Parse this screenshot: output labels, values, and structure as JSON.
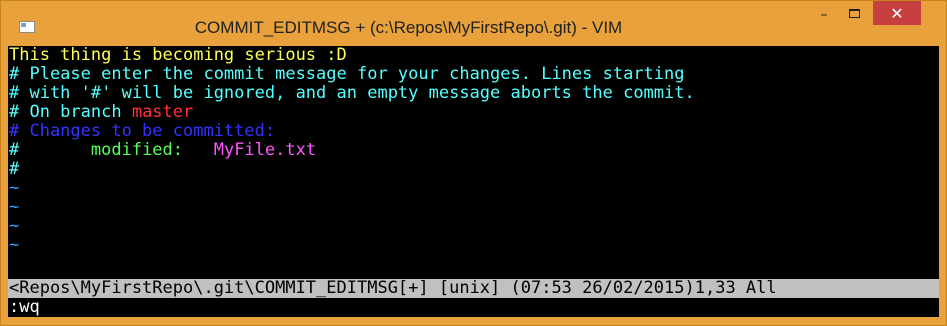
{
  "window": {
    "title": "COMMIT_EDITMSG + (c:\\Repos\\MyFirstRepo\\.git) - VIM",
    "minimize_glyph": "–",
    "close_glyph": "✕",
    "app_icon": "vim-app-icon"
  },
  "editor": {
    "line1": "This thing is becoming serious :D",
    "line2": "# Please enter the commit message for your changes. Lines starting",
    "line3": "# with '#' will be ignored, and an empty message aborts the commit.",
    "line4_prefix": "# On branch ",
    "line4_branch": "master",
    "line5": "# Changes to be committed:",
    "line6_hash": "#",
    "line6_status": "       modified:   ",
    "line6_file": "MyFile.txt",
    "line7": "#",
    "tilde": "~"
  },
  "status_line": "<Repos\\MyFirstRepo\\.git\\COMMIT_EDITMSG[+] [unix] (07:53 26/02/2015)1,33 All",
  "command_line": ":wq",
  "colors": {
    "frame": "#e9a23b",
    "close": "#c74040",
    "terminal_bg": "#000000",
    "message": "#ffff55",
    "comment": "#55ffff",
    "branch": "#ff3333",
    "header": "#3333ff",
    "modified": "#55ff55",
    "file": "#ff55ff",
    "tilde": "#3aa0ff",
    "statusline": "#c0c0c0"
  }
}
